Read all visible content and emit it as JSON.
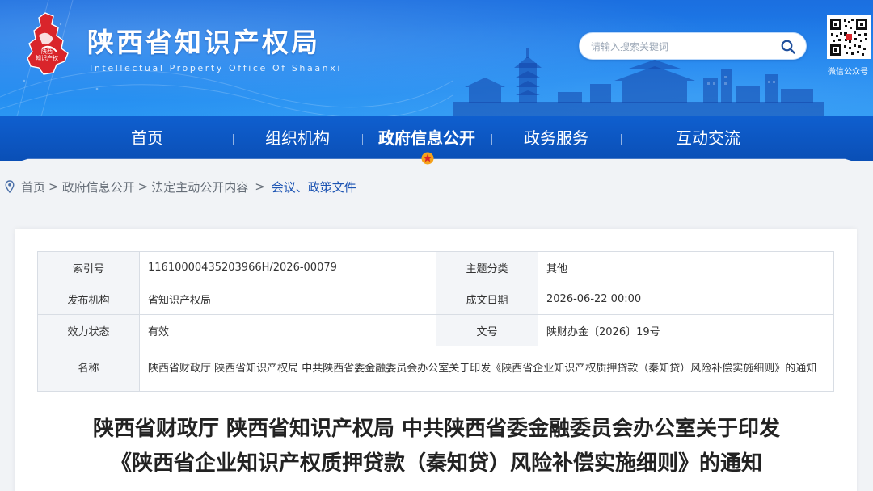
{
  "header": {
    "site_title": "陕西省知识产权局",
    "site_subtitle": "Intellectual Property Office Of Shaanxi",
    "logo_text_line1": "陕西",
    "logo_text_line2": "知识产权",
    "search_placeholder": "请输入搜索关键词",
    "qr_label": "微信公众号",
    "colors": {
      "banner": "#1e83ee",
      "nav": "#0f5fcf",
      "accent_star": "#f5a21b"
    }
  },
  "nav": {
    "items": [
      {
        "label": "首页",
        "active": false
      },
      {
        "label": "组织机构",
        "active": false
      },
      {
        "label": "政府信息公开",
        "active": true
      },
      {
        "label": "政务服务",
        "active": false
      },
      {
        "label": "互动交流",
        "active": false
      }
    ]
  },
  "breadcrumb": {
    "items": [
      "首页",
      "政府信息公开",
      "法定主动公开内容"
    ],
    "current": "会议、政策文件",
    "separator": ">"
  },
  "meta": {
    "index_label": "索引号",
    "index_value": "11610000435203966H/2026-00079",
    "topic_label": "主题分类",
    "topic_value": "其他",
    "issuer_label": "发布机构",
    "issuer_value": "省知识产权局",
    "date_label": "成文日期",
    "date_value": "2026-06-22 00:00",
    "status_label": "效力状态",
    "status_value": "有效",
    "docno_label": "文号",
    "docno_value": "陕财办金〔2026〕19号",
    "name_label": "名称",
    "name_value": "陕西省财政厅 陕西省知识产权局 中共陕西省委金融委员会办公室关于印发《陕西省企业知识产权质押贷款（秦知贷）风险补偿实施细则》的通知"
  },
  "document": {
    "title_line1": "陕西省财政厅 陕西省知识产权局 中共陕西省委金融委员会办公室关于印发",
    "title_line2": "《陕西省企业知识产权质押贷款（秦知贷）风险补偿实施细则》的通知"
  }
}
